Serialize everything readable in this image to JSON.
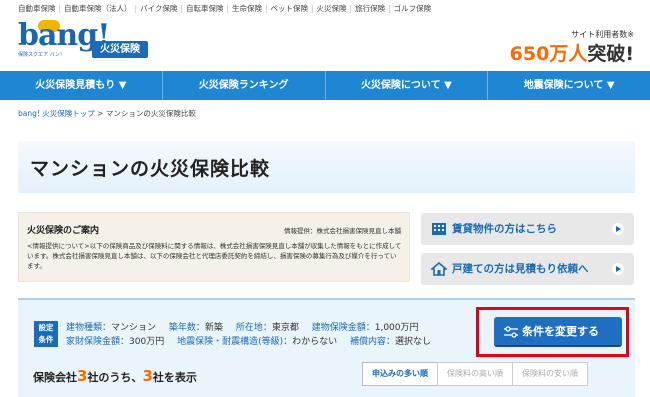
{
  "topnav": [
    "自動車保険",
    "自動車保険（法人）",
    "バイク保険",
    "自転車保険",
    "生命保険",
    "ペット保険",
    "火災保険",
    "旅行保険",
    "ゴルフ保険"
  ],
  "logo": {
    "word": "bang!",
    "sub": "保険スクエア バン！"
  },
  "site_badge": "火災保険",
  "users": {
    "label": "サイト利用者数※",
    "count": "650万人",
    "suffix": "突破!"
  },
  "mainnav": [
    "火災保険見積もり ▼",
    "火災保険ランキング",
    "火災保険について ▼",
    "地震保険について ▼"
  ],
  "breadcrumb": {
    "home": "bang! 火災保険トップ",
    "sep": " > ",
    "current": "マンションの火災保険比較"
  },
  "page_title": "マンションの火災保険比較",
  "guide": {
    "title": "火災保険のご案内",
    "source": "情報提供：株式会社損害保険見直し本舗",
    "body": "<情報提供について>以下の保険商品及び保険料に関する情報は、株式会社損害保険見直し本舗が収集した情報をもとに作成しています。株式会社損害保険見直し本舗は、以下の保険会社と代理店委託契約を締結し、損害保険の募集行為及び媒介を行っています。"
  },
  "side_buttons": {
    "rental": "賃貸物件の方はこちら",
    "house": "戸建ての方は見積もり依頼へ"
  },
  "conditions": {
    "tag_line1": "設定",
    "tag_line2": "条件",
    "row1": [
      {
        "k": "建物種類：",
        "v": "マンション"
      },
      {
        "k": "築年数：",
        "v": "新築"
      },
      {
        "k": "所在地：",
        "v": "東京都"
      },
      {
        "k": "建物保険金額：",
        "v": "1,000万円"
      }
    ],
    "row2": [
      {
        "k": "家財保険金額：",
        "v": "300万円"
      },
      {
        "k": "地震保険・耐震構造(等級)：",
        "v": "わからない"
      },
      {
        "k": "補償内容：",
        "v": "選択なし"
      }
    ]
  },
  "change_button": "条件を変更する",
  "result": {
    "pre": "保険会社",
    "total": "3",
    "mid": "社のうち、",
    "shown": "3",
    "post": "社を表示"
  },
  "sort_options": [
    "申込みの多い順",
    "保険料の高い順",
    "保険料の安い順"
  ],
  "colors": {
    "brand_blue": "#1f86d3",
    "accent_orange": "#ff6a00",
    "highlight_red": "#e0001a"
  }
}
